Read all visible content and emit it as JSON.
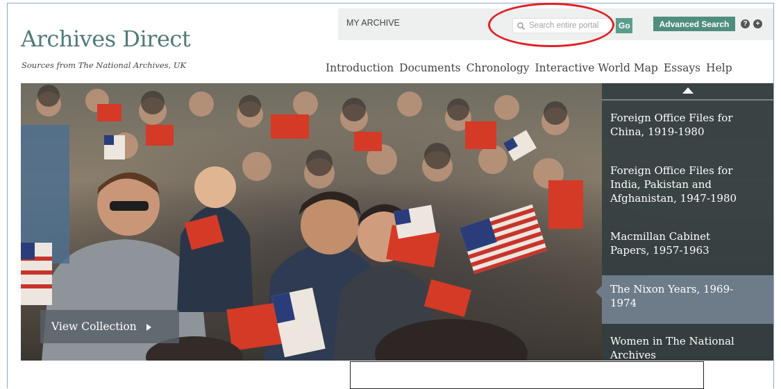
{
  "brand": {
    "title": "Archives Direct",
    "subtitle": "Sources from The National Archives, UK"
  },
  "topbar": {
    "my_archive": "MY ARCHIVE",
    "search_placeholder": "Search entire portal",
    "go_label": "Go",
    "advanced_search_label": "Advanced Search",
    "help_icon": "?",
    "plus_icon": "+"
  },
  "nav": {
    "items": [
      "Introduction",
      "Documents",
      "Chronology",
      "Interactive World Map",
      "Essays",
      "Help"
    ]
  },
  "hero": {
    "view_collection_label": "View Collection"
  },
  "collections": {
    "items": [
      "Foreign Office Files for\nChina, 1919-1980",
      "Foreign Office Files for\nIndia, Pakistan and\nAfghanistan, 1947-1980",
      "Macmillan Cabinet\nPapers, 1957-1963",
      "The Nixon Years, 1969-\n1974",
      "Women in The National\nArchives"
    ],
    "active_index": 3
  },
  "colors": {
    "brand": "#4f7a78",
    "go_button": "#5b9d8d",
    "advanced_button": "#4f8e7f",
    "panel": "#333e40",
    "panel_active": "#6e7c8a",
    "annotation": "#e31e24"
  }
}
